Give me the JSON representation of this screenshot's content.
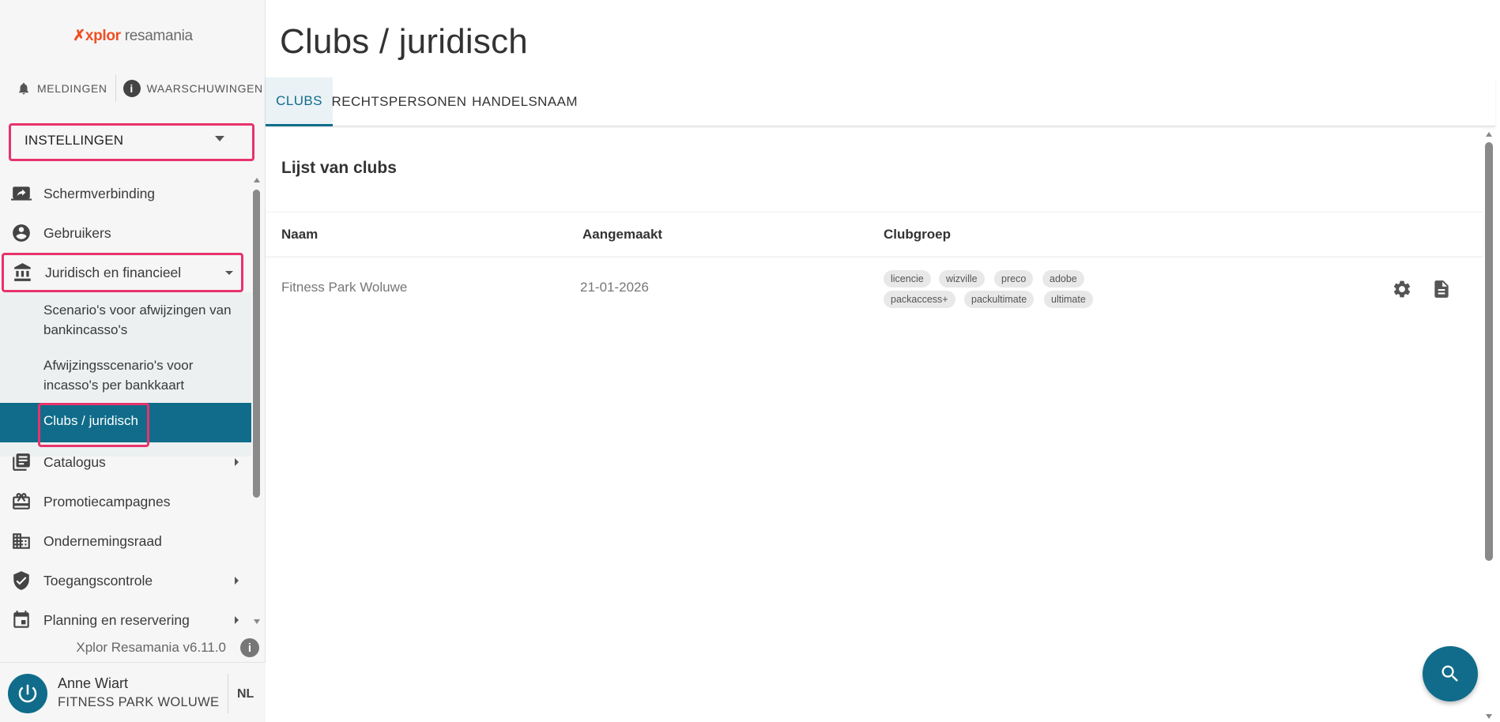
{
  "sidebar": {
    "logo": {
      "brand_a": "xplor",
      "brand_b": "resamania"
    },
    "alerts": {
      "notifications_label": "MELDINGEN",
      "warnings_label": "WAARSCHUWINGEN"
    },
    "section_select": {
      "value": "INSTELLINGEN"
    },
    "nav": {
      "items": [
        {
          "label": "Schermverbinding",
          "icon": "screen-share-icon"
        },
        {
          "label": "Gebruikers",
          "icon": "account-circle-icon"
        },
        {
          "label": "Juridisch en financieel",
          "icon": "bank-icon",
          "expanded": true
        },
        {
          "label": "Catalogus",
          "icon": "library-books-icon"
        },
        {
          "label": "Promotiecampagnes",
          "icon": "redeem-icon"
        },
        {
          "label": "Ondernemingsraad",
          "icon": "business-icon"
        },
        {
          "label": "Toegangscontrole",
          "icon": "verified-user-icon"
        },
        {
          "label": "Planning en reservering",
          "icon": "calendar-icon"
        }
      ],
      "subitems": [
        {
          "label": "Scenario's voor afwijzingen van bankincasso's"
        },
        {
          "label": "Afwijzingsscenario's voor incasso's per bankkaart"
        },
        {
          "label": "Clubs / juridisch",
          "active": true
        }
      ]
    },
    "version": "Xplor Resamania v6.11.0",
    "user": {
      "name": "Anne Wiart",
      "club": "FITNESS PARK WOLUWE",
      "language": "NL"
    }
  },
  "main": {
    "title": "Clubs / juridisch",
    "tabs": [
      {
        "label": "CLUBS",
        "active": true
      },
      {
        "label": "RECHTSPERSONEN"
      },
      {
        "label": "HANDELSNAAM"
      }
    ],
    "list": {
      "title": "Lijst van clubs",
      "columns": [
        "Naam",
        "Aangemaakt",
        "Clubgroep"
      ],
      "rows": [
        {
          "name": "Fitness Park Woluwe",
          "created": "21-01-2026",
          "groups": [
            "licencie",
            "wizville",
            "preco",
            "adobe",
            "packaccess+",
            "packultimate",
            "ultimate"
          ]
        }
      ]
    }
  },
  "colors": {
    "primary": "#106c8a",
    "highlight": "#e8336c",
    "brand": "#f04e23"
  }
}
